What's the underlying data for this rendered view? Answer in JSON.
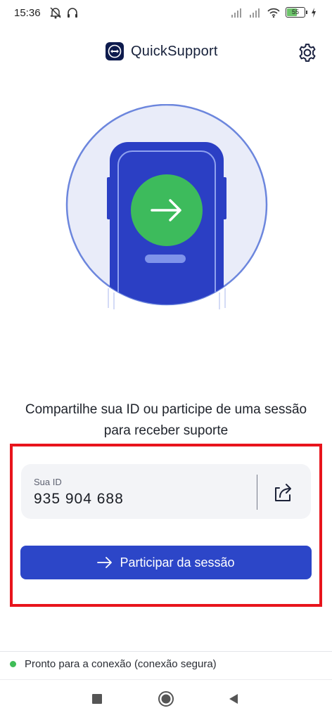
{
  "status_bar": {
    "time": "15:36",
    "battery_level": "55",
    "left_icons": [
      "notifications-off-icon",
      "headphones-icon"
    ],
    "right_icons": [
      "signal-icon",
      "signal-icon",
      "wifi-icon",
      "battery-icon",
      "charging-icon"
    ]
  },
  "header": {
    "title": "QuickSupport",
    "logo_icon": "teamviewer-logo-icon",
    "settings_icon": "gear-icon"
  },
  "illustration": {
    "description_icon": "arrow-right-icon",
    "colors": {
      "circle_bg": "#e9ecf9",
      "circle_border": "#6c86dd",
      "phone": "#2b3fc4",
      "accent": "#3dbb5c"
    }
  },
  "main": {
    "description": "Compartilhe sua ID ou participe de uma sessão para receber suporte",
    "id_label": "Sua ID",
    "id_value": "935 904 688",
    "share_icon": "share-icon",
    "join_label": "Participar da sessão",
    "join_icon": "arrow-right-icon"
  },
  "connection": {
    "status_text": "Pronto para a conexão (conexão segura)",
    "status_color": "#3fbd57"
  },
  "navigation": {
    "buttons": [
      "recents-square-icon",
      "home-circle-icon",
      "back-triangle-icon"
    ]
  },
  "colors": {
    "primary": "#2c46c8",
    "highlight": "#e8141c",
    "card_bg": "#f3f4f7"
  }
}
